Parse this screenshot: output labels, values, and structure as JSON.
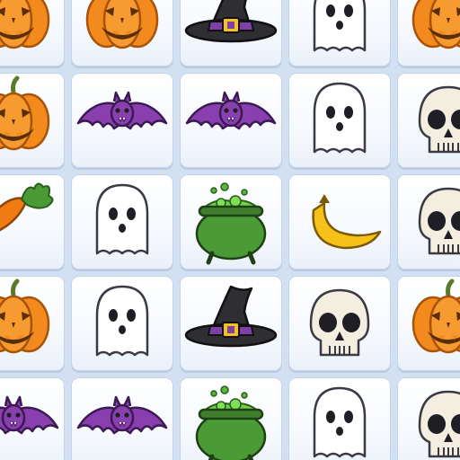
{
  "board": {
    "rows": [
      [
        "pumpkin",
        "pumpkin",
        "witch-hat",
        "ghost",
        "pumpkin"
      ],
      [
        "pumpkin",
        "bat",
        "bat",
        "ghost",
        "skull"
      ],
      [
        "carrot",
        "ghost",
        "cauldron",
        "banana",
        "skull"
      ],
      [
        "pumpkin",
        "ghost",
        "witch-hat",
        "skull",
        "pumpkin"
      ],
      [
        "bat",
        "bat",
        "cauldron",
        "ghost",
        "skull"
      ]
    ]
  },
  "colors": {
    "pumpkin": "#f28a1e",
    "bat": "#8a3fb0",
    "ghost": "#ffffff",
    "skull": "#f3eee0",
    "witch_hat": "#2e2e33",
    "cauldron": "#4a9a35",
    "banana": "#f6c21a",
    "carrot": "#f07a14"
  }
}
